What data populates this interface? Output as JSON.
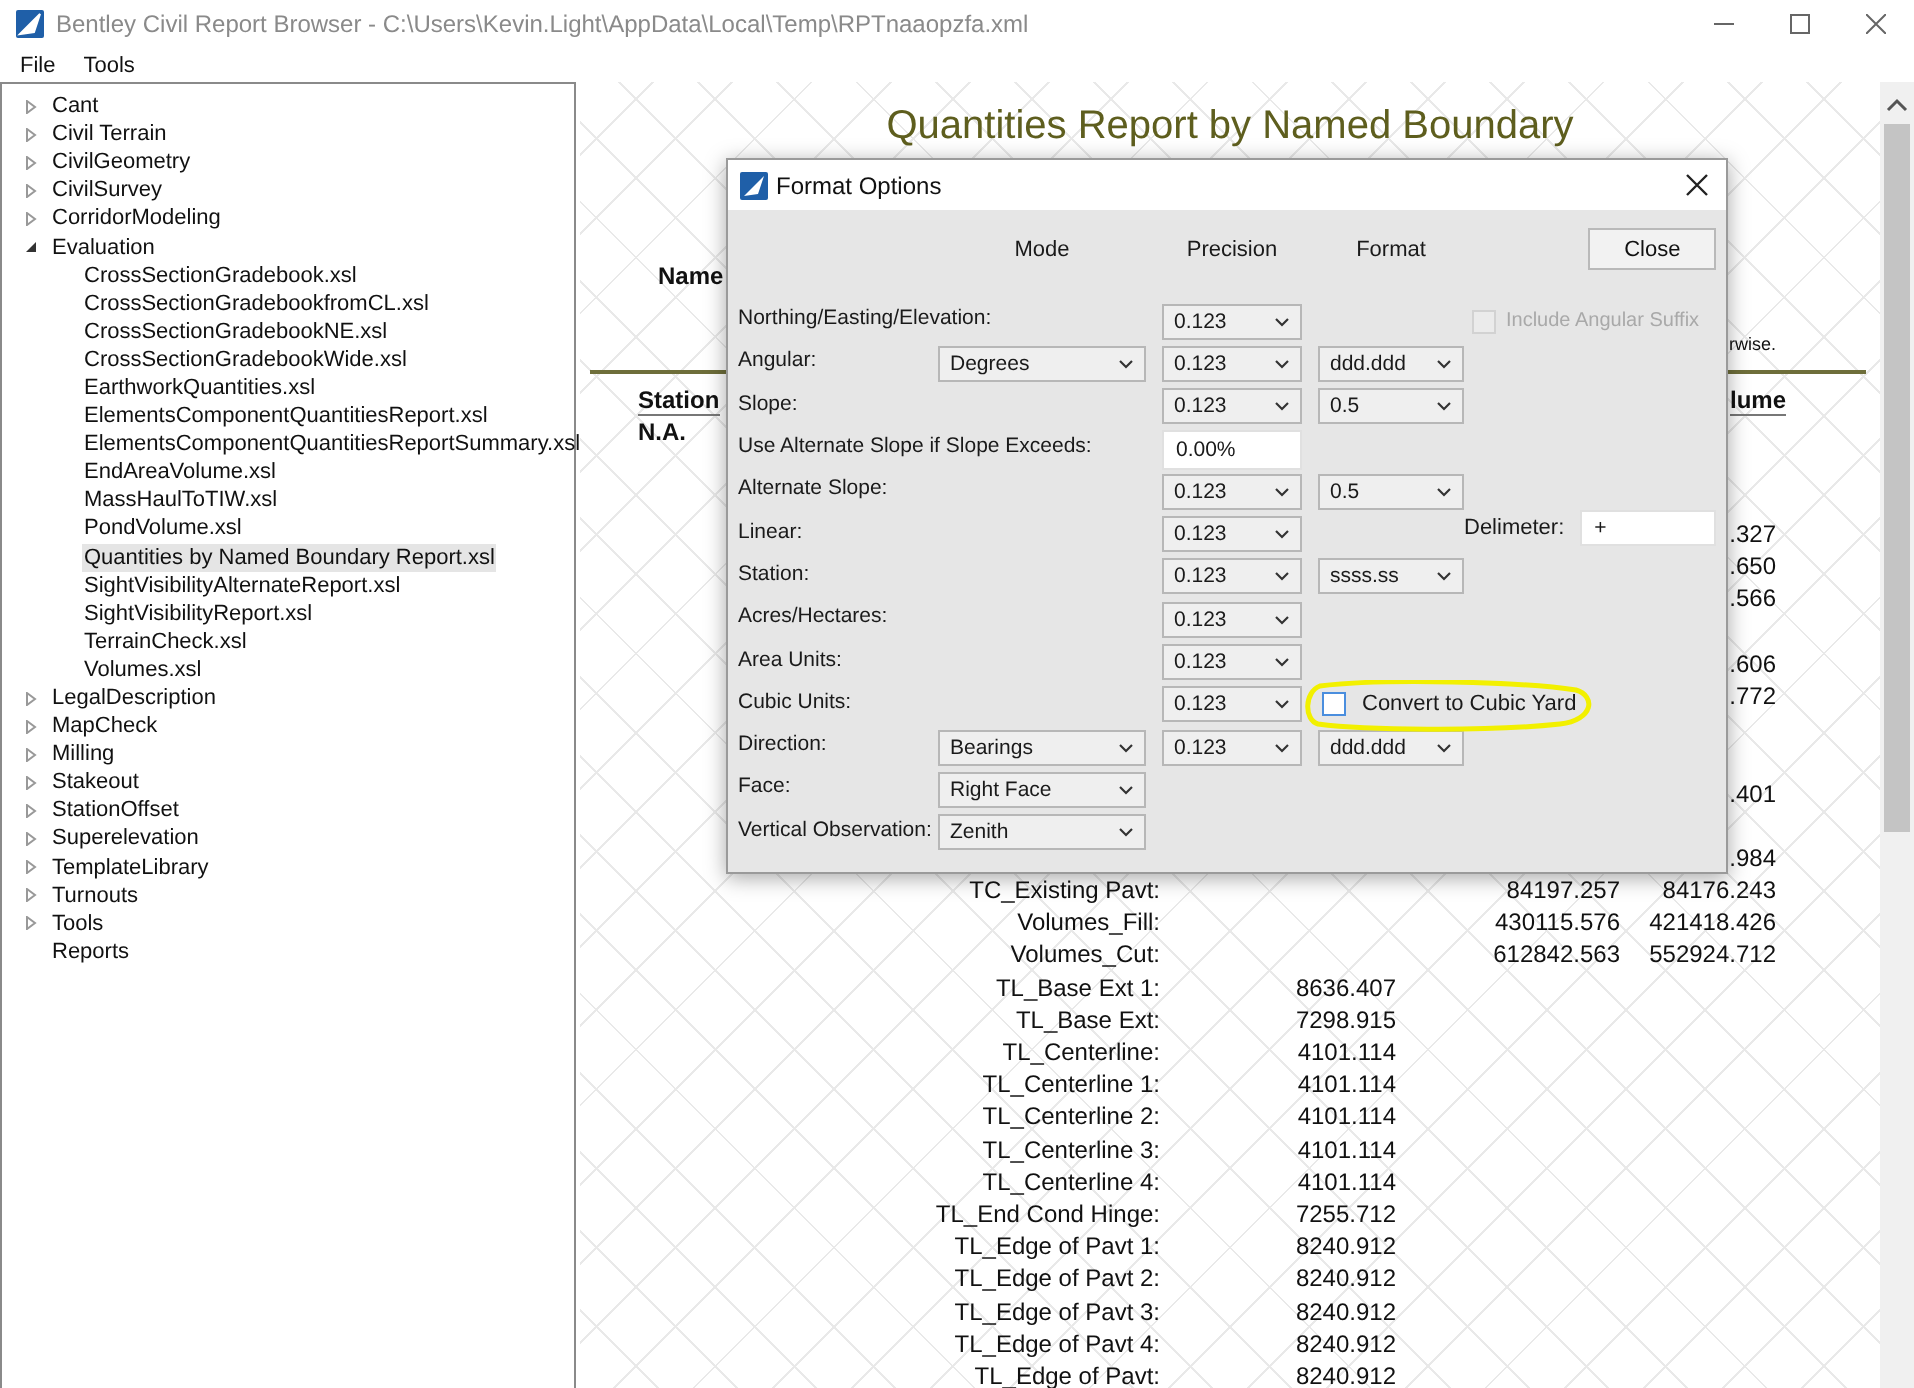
{
  "window": {
    "title": "Bentley Civil Report Browser - C:\\Users\\Kevin.Light\\AppData\\Local\\Temp\\RPTnaaopzfa.xml"
  },
  "menu": [
    "File",
    "Tools"
  ],
  "tree": [
    {
      "kind": "group",
      "label": "Cant",
      "expanded": false,
      "selected": false
    },
    {
      "kind": "group",
      "label": "Civil Terrain",
      "expanded": false,
      "selected": false
    },
    {
      "kind": "group",
      "label": "CivilGeometry",
      "expanded": false,
      "selected": false
    },
    {
      "kind": "group",
      "label": "CivilSurvey",
      "expanded": false,
      "selected": false
    },
    {
      "kind": "group",
      "label": "CorridorModeling",
      "expanded": false,
      "selected": false
    },
    {
      "kind": "group",
      "label": "Evaluation",
      "expanded": true,
      "selected": false,
      "children": [
        {
          "label": "CrossSectionGradebook.xsl",
          "selected": false
        },
        {
          "label": "CrossSectionGradebookfromCL.xsl",
          "selected": false
        },
        {
          "label": "CrossSectionGradebookNE.xsl",
          "selected": false
        },
        {
          "label": "CrossSectionGradebookWide.xsl",
          "selected": false
        },
        {
          "label": "EarthworkQuantities.xsl",
          "selected": false
        },
        {
          "label": "ElementsComponentQuantitiesReport.xsl",
          "selected": false
        },
        {
          "label": "ElementsComponentQuantitiesReportSummary.xsl",
          "selected": false
        },
        {
          "label": "EndAreaVolume.xsl",
          "selected": false
        },
        {
          "label": "MassHaulToTIW.xsl",
          "selected": false
        },
        {
          "label": "PondVolume.xsl",
          "selected": false
        },
        {
          "label": "Quantities by Named Boundary Report.xsl",
          "selected": true
        },
        {
          "label": "SightVisibilityAlternateReport.xsl",
          "selected": false
        },
        {
          "label": "SightVisibilityReport.xsl",
          "selected": false
        },
        {
          "label": "TerrainCheck.xsl",
          "selected": false
        },
        {
          "label": "Volumes.xsl",
          "selected": false
        }
      ]
    },
    {
      "kind": "group",
      "label": "LegalDescription",
      "expanded": false,
      "selected": false
    },
    {
      "kind": "group",
      "label": "MapCheck",
      "expanded": false,
      "selected": false
    },
    {
      "kind": "group",
      "label": "Milling",
      "expanded": false,
      "selected": false
    },
    {
      "kind": "group",
      "label": "Stakeout",
      "expanded": false,
      "selected": false
    },
    {
      "kind": "group",
      "label": "StationOffset",
      "expanded": false,
      "selected": false
    },
    {
      "kind": "group",
      "label": "Superelevation",
      "expanded": false,
      "selected": false
    },
    {
      "kind": "group",
      "label": "TemplateLibrary",
      "expanded": false,
      "selected": false
    },
    {
      "kind": "group",
      "label": "Turnouts",
      "expanded": false,
      "selected": false
    },
    {
      "kind": "group",
      "label": "Tools",
      "expanded": false,
      "selected": false
    },
    {
      "kind": "leaf",
      "label": "Reports",
      "selected": false
    }
  ],
  "report": {
    "title": "Quantities Report by Named Boundary",
    "heading_fragment": "Name",
    "note_fragment": "rwise.",
    "column_1": "Station",
    "column_4": "lume",
    "first_cell": "N.A.",
    "partial_values": [
      ".327",
      ".650",
      ".566",
      ".606",
      ".772",
      ".401",
      ".984"
    ],
    "rows": [
      {
        "label": "TC_Existing Pavt:",
        "column_3": "84197.257",
        "column_4": "84176.243"
      },
      {
        "label": "Volumes_Fill:",
        "column_3": "430115.576",
        "column_4": "421418.426"
      },
      {
        "label": "Volumes_Cut:",
        "column_3": "612842.563",
        "column_4": "552924.712"
      },
      {
        "label": "TL_Base Ext 1:",
        "column_2": "8636.407"
      },
      {
        "label": "TL_Base Ext:",
        "column_2": "7298.915"
      },
      {
        "label": "TL_Centerline:",
        "column_2": "4101.114"
      },
      {
        "label": "TL_Centerline 1:",
        "column_2": "4101.114"
      },
      {
        "label": "TL_Centerline 2:",
        "column_2": "4101.114"
      },
      {
        "label": "TL_Centerline 3:",
        "column_2": "4101.114"
      },
      {
        "label": "TL_Centerline 4:",
        "column_2": "4101.114"
      },
      {
        "label": "TL_End Cond Hinge:",
        "column_2": "7255.712"
      },
      {
        "label": "TL_Edge of Pavt 1:",
        "column_2": "8240.912"
      },
      {
        "label": "TL_Edge of Pavt 2:",
        "column_2": "8240.912"
      },
      {
        "label": "TL_Edge of Pavt 3:",
        "column_2": "8240.912"
      },
      {
        "label": "TL_Edge of Pavt 4:",
        "column_2": "8240.912"
      },
      {
        "label": "TL_Edge of Pavt:",
        "column_2": "8240.912"
      }
    ]
  },
  "dialog": {
    "title": "Format Options",
    "headers": [
      "Mode",
      "Precision",
      "Format"
    ],
    "close_button": "Close",
    "rows": [
      {
        "kind": "selects",
        "label": "Northing/Easting/Elevation:",
        "precision": "0.123"
      },
      {
        "kind": "selects",
        "label": "Angular:",
        "mode": "Degrees",
        "precision": "0.123",
        "format": "ddd.ddd"
      },
      {
        "kind": "selects",
        "label": "Slope:",
        "precision": "0.123",
        "format": "0.5"
      },
      {
        "kind": "text",
        "label": "Use Alternate Slope if Slope Exceeds:",
        "value": "0.00%"
      },
      {
        "kind": "selects",
        "label": "Alternate Slope:",
        "precision": "0.123",
        "format": "0.5"
      },
      {
        "kind": "selects",
        "label": "Linear:",
        "precision": "0.123"
      },
      {
        "kind": "selects",
        "label": "Station:",
        "precision": "0.123",
        "format": "ssss.ss"
      },
      {
        "kind": "selects",
        "label": "Acres/Hectares:",
        "precision": "0.123"
      },
      {
        "kind": "selects",
        "label": "Area Units:",
        "precision": "0.123"
      },
      {
        "kind": "selects",
        "label": "Cubic Units:",
        "precision": "0.123"
      },
      {
        "kind": "selects",
        "label": "Direction:",
        "mode": "Bearings",
        "precision": "0.123",
        "format": "ddd.ddd"
      },
      {
        "kind": "selects",
        "label": "Face:",
        "mode": "Right Face"
      },
      {
        "kind": "selects",
        "label": "Vertical Observation:",
        "mode": "Zenith"
      }
    ],
    "angular_suffix": {
      "label": "Include Angular Suffix",
      "checked": false,
      "disabled": true
    },
    "delimeter": {
      "label": "Delimeter:",
      "value": "+"
    },
    "cubic_yard": {
      "label": "Convert to Cubic Yard",
      "checked": false,
      "disabled": false
    }
  }
}
